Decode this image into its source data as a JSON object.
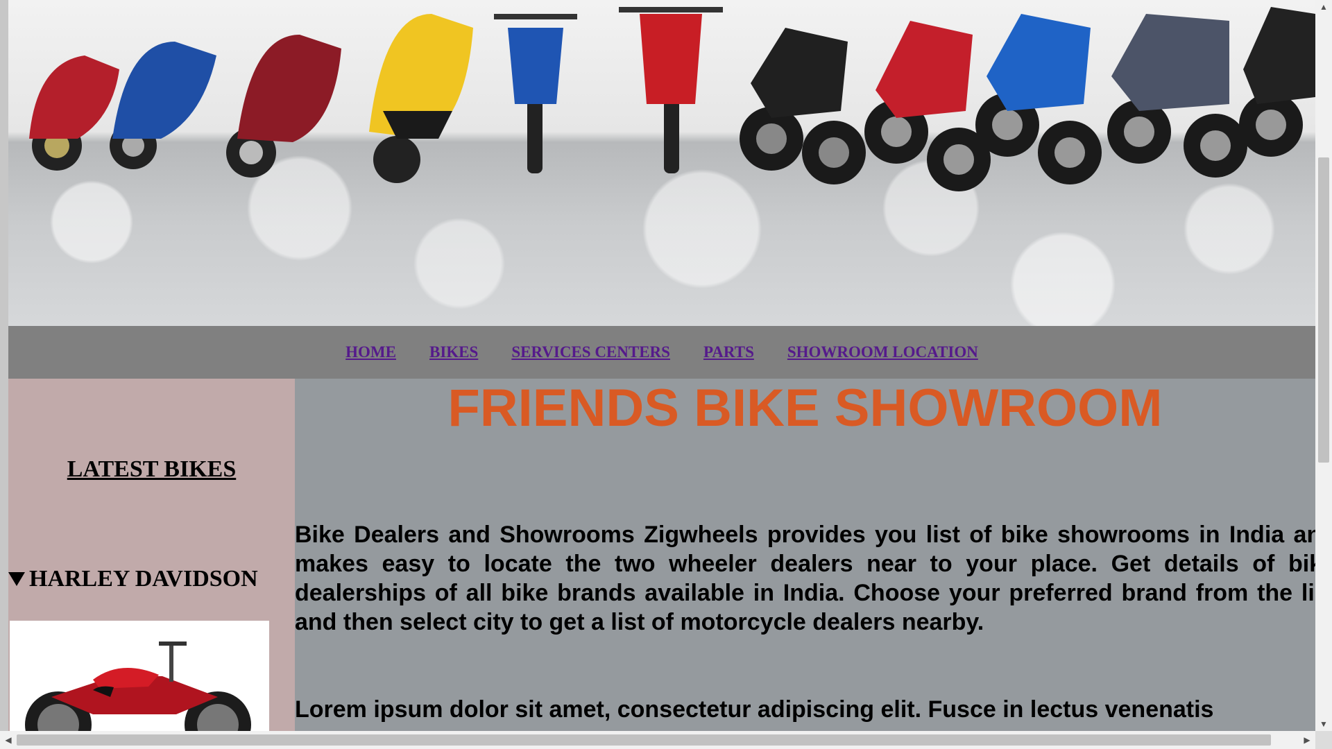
{
  "nav": {
    "items": [
      {
        "label": "HOME"
      },
      {
        "label": "BIKES"
      },
      {
        "label": "SERVICES CENTERS"
      },
      {
        "label": "PARTS"
      },
      {
        "label": "SHOWROOM LOCATION"
      }
    ],
    "link_color": "#551a8b",
    "bar_color": "#808080"
  },
  "sidebar": {
    "heading": "LATEST BIKES",
    "section_title": "HARLEY DAVIDSON",
    "background": "#c1aaaa"
  },
  "main": {
    "title": "FRIENDS BIKE SHOWROOM",
    "title_color": "#d95a24",
    "paragraph1": "Bike Dealers and Showrooms Zigwheels provides you list of bike showrooms in India and makes easy to locate the two wheeler dealers near to your place. Get details of bike dealerships of all bike brands available in India. Choose your preferred brand from the list and then select city to get a list of motorcycle dealers nearby.",
    "paragraph2": "Lorem ipsum dolor sit amet, consectetur adipiscing elit. Fusce in lectus venenatis",
    "background": "#959a9e"
  },
  "icons": {
    "hero": "motorcycles-banner-image",
    "bike": "harley-motorcycle-image",
    "disclosure": "triangle-down-icon"
  }
}
